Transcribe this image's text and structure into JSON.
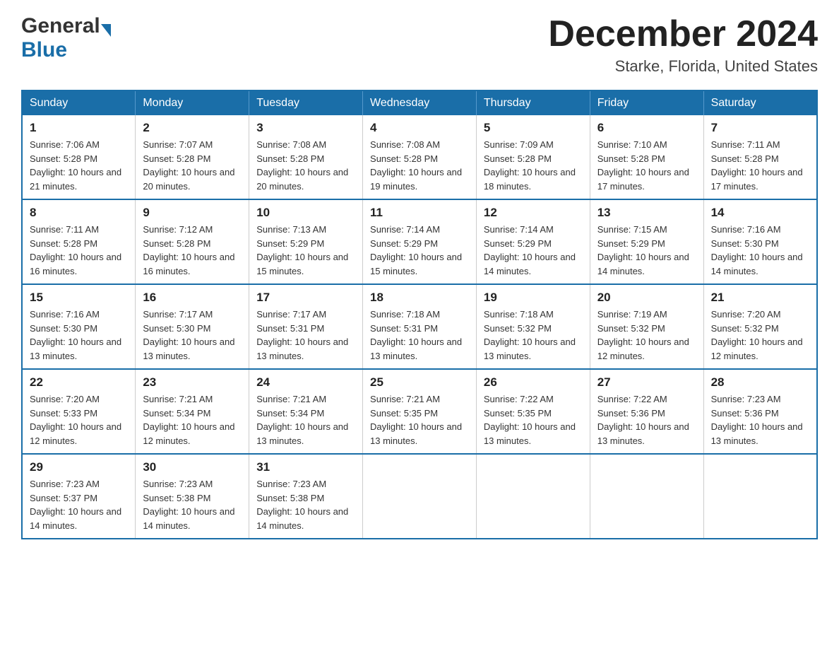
{
  "header": {
    "logo_general": "General",
    "logo_blue": "Blue",
    "month_title": "December 2024",
    "location": "Starke, Florida, United States"
  },
  "days_of_week": [
    "Sunday",
    "Monday",
    "Tuesday",
    "Wednesday",
    "Thursday",
    "Friday",
    "Saturday"
  ],
  "weeks": [
    [
      {
        "day": "1",
        "sunrise": "Sunrise: 7:06 AM",
        "sunset": "Sunset: 5:28 PM",
        "daylight": "Daylight: 10 hours and 21 minutes."
      },
      {
        "day": "2",
        "sunrise": "Sunrise: 7:07 AM",
        "sunset": "Sunset: 5:28 PM",
        "daylight": "Daylight: 10 hours and 20 minutes."
      },
      {
        "day": "3",
        "sunrise": "Sunrise: 7:08 AM",
        "sunset": "Sunset: 5:28 PM",
        "daylight": "Daylight: 10 hours and 20 minutes."
      },
      {
        "day": "4",
        "sunrise": "Sunrise: 7:08 AM",
        "sunset": "Sunset: 5:28 PM",
        "daylight": "Daylight: 10 hours and 19 minutes."
      },
      {
        "day": "5",
        "sunrise": "Sunrise: 7:09 AM",
        "sunset": "Sunset: 5:28 PM",
        "daylight": "Daylight: 10 hours and 18 minutes."
      },
      {
        "day": "6",
        "sunrise": "Sunrise: 7:10 AM",
        "sunset": "Sunset: 5:28 PM",
        "daylight": "Daylight: 10 hours and 17 minutes."
      },
      {
        "day": "7",
        "sunrise": "Sunrise: 7:11 AM",
        "sunset": "Sunset: 5:28 PM",
        "daylight": "Daylight: 10 hours and 17 minutes."
      }
    ],
    [
      {
        "day": "8",
        "sunrise": "Sunrise: 7:11 AM",
        "sunset": "Sunset: 5:28 PM",
        "daylight": "Daylight: 10 hours and 16 minutes."
      },
      {
        "day": "9",
        "sunrise": "Sunrise: 7:12 AM",
        "sunset": "Sunset: 5:28 PM",
        "daylight": "Daylight: 10 hours and 16 minutes."
      },
      {
        "day": "10",
        "sunrise": "Sunrise: 7:13 AM",
        "sunset": "Sunset: 5:29 PM",
        "daylight": "Daylight: 10 hours and 15 minutes."
      },
      {
        "day": "11",
        "sunrise": "Sunrise: 7:14 AM",
        "sunset": "Sunset: 5:29 PM",
        "daylight": "Daylight: 10 hours and 15 minutes."
      },
      {
        "day": "12",
        "sunrise": "Sunrise: 7:14 AM",
        "sunset": "Sunset: 5:29 PM",
        "daylight": "Daylight: 10 hours and 14 minutes."
      },
      {
        "day": "13",
        "sunrise": "Sunrise: 7:15 AM",
        "sunset": "Sunset: 5:29 PM",
        "daylight": "Daylight: 10 hours and 14 minutes."
      },
      {
        "day": "14",
        "sunrise": "Sunrise: 7:16 AM",
        "sunset": "Sunset: 5:30 PM",
        "daylight": "Daylight: 10 hours and 14 minutes."
      }
    ],
    [
      {
        "day": "15",
        "sunrise": "Sunrise: 7:16 AM",
        "sunset": "Sunset: 5:30 PM",
        "daylight": "Daylight: 10 hours and 13 minutes."
      },
      {
        "day": "16",
        "sunrise": "Sunrise: 7:17 AM",
        "sunset": "Sunset: 5:30 PM",
        "daylight": "Daylight: 10 hours and 13 minutes."
      },
      {
        "day": "17",
        "sunrise": "Sunrise: 7:17 AM",
        "sunset": "Sunset: 5:31 PM",
        "daylight": "Daylight: 10 hours and 13 minutes."
      },
      {
        "day": "18",
        "sunrise": "Sunrise: 7:18 AM",
        "sunset": "Sunset: 5:31 PM",
        "daylight": "Daylight: 10 hours and 13 minutes."
      },
      {
        "day": "19",
        "sunrise": "Sunrise: 7:18 AM",
        "sunset": "Sunset: 5:32 PM",
        "daylight": "Daylight: 10 hours and 13 minutes."
      },
      {
        "day": "20",
        "sunrise": "Sunrise: 7:19 AM",
        "sunset": "Sunset: 5:32 PM",
        "daylight": "Daylight: 10 hours and 12 minutes."
      },
      {
        "day": "21",
        "sunrise": "Sunrise: 7:20 AM",
        "sunset": "Sunset: 5:32 PM",
        "daylight": "Daylight: 10 hours and 12 minutes."
      }
    ],
    [
      {
        "day": "22",
        "sunrise": "Sunrise: 7:20 AM",
        "sunset": "Sunset: 5:33 PM",
        "daylight": "Daylight: 10 hours and 12 minutes."
      },
      {
        "day": "23",
        "sunrise": "Sunrise: 7:21 AM",
        "sunset": "Sunset: 5:34 PM",
        "daylight": "Daylight: 10 hours and 12 minutes."
      },
      {
        "day": "24",
        "sunrise": "Sunrise: 7:21 AM",
        "sunset": "Sunset: 5:34 PM",
        "daylight": "Daylight: 10 hours and 13 minutes."
      },
      {
        "day": "25",
        "sunrise": "Sunrise: 7:21 AM",
        "sunset": "Sunset: 5:35 PM",
        "daylight": "Daylight: 10 hours and 13 minutes."
      },
      {
        "day": "26",
        "sunrise": "Sunrise: 7:22 AM",
        "sunset": "Sunset: 5:35 PM",
        "daylight": "Daylight: 10 hours and 13 minutes."
      },
      {
        "day": "27",
        "sunrise": "Sunrise: 7:22 AM",
        "sunset": "Sunset: 5:36 PM",
        "daylight": "Daylight: 10 hours and 13 minutes."
      },
      {
        "day": "28",
        "sunrise": "Sunrise: 7:23 AM",
        "sunset": "Sunset: 5:36 PM",
        "daylight": "Daylight: 10 hours and 13 minutes."
      }
    ],
    [
      {
        "day": "29",
        "sunrise": "Sunrise: 7:23 AM",
        "sunset": "Sunset: 5:37 PM",
        "daylight": "Daylight: 10 hours and 14 minutes."
      },
      {
        "day": "30",
        "sunrise": "Sunrise: 7:23 AM",
        "sunset": "Sunset: 5:38 PM",
        "daylight": "Daylight: 10 hours and 14 minutes."
      },
      {
        "day": "31",
        "sunrise": "Sunrise: 7:23 AM",
        "sunset": "Sunset: 5:38 PM",
        "daylight": "Daylight: 10 hours and 14 minutes."
      },
      null,
      null,
      null,
      null
    ]
  ]
}
